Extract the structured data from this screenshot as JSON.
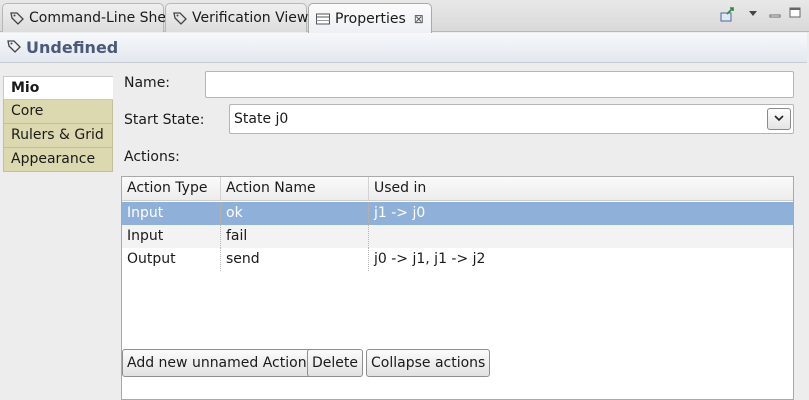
{
  "tabs": [
    {
      "label": "Command-Line Shell",
      "icon": "tag-icon"
    },
    {
      "label": "Verification View",
      "icon": "tag-icon"
    },
    {
      "label": "Properties",
      "icon": "properties-table-icon",
      "active": true,
      "close": "⊠"
    }
  ],
  "view_menu": {
    "pin_icon": "pin-icon",
    "menu_icon": "view-menu-icon",
    "minimize_icon": "minimize-icon",
    "maximize_icon": "maximize-icon"
  },
  "header": {
    "title": "Undefined",
    "icon": "tag-icon"
  },
  "side_tabs": [
    {
      "label": "Mio",
      "active": true
    },
    {
      "label": "Core"
    },
    {
      "label": "Rulers & Grid"
    },
    {
      "label": "Appearance"
    }
  ],
  "form": {
    "name_label": "Name:",
    "name_value": "",
    "start_state_label": "Start State:",
    "start_state_value": "State j0",
    "actions_label": "Actions:"
  },
  "table": {
    "columns": [
      "Action Type",
      "Action Name",
      "Used in"
    ],
    "rows": [
      {
        "type": "Input",
        "name": "ok",
        "used": "j1 -> j0",
        "selected": true
      },
      {
        "type": "Input",
        "name": "fail",
        "used": ""
      },
      {
        "type": "Output",
        "name": "send",
        "used": "j0 -> j1, j1 -> j2"
      }
    ]
  },
  "buttons": {
    "add": "Add new unnamed Action",
    "delete": "Delete",
    "collapse": "Collapse actions"
  },
  "colors": {
    "selection": "#8fb0d9",
    "header_title": "#4a5a78",
    "side_tab": "#dcd9b0"
  }
}
